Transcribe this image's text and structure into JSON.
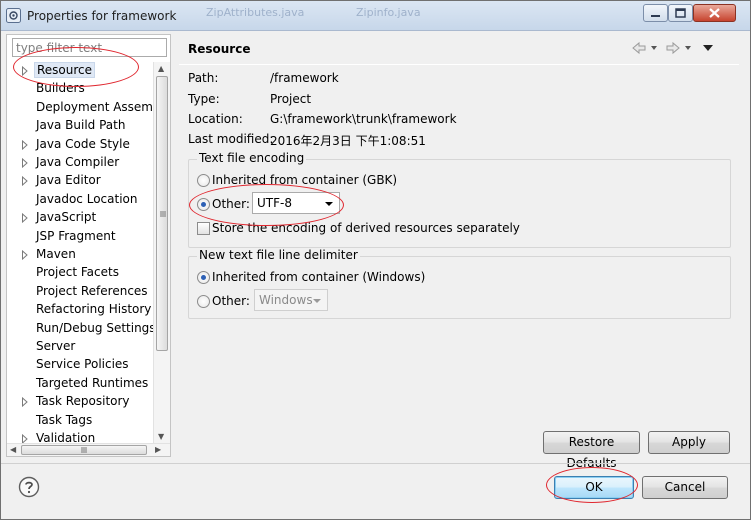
{
  "window": {
    "title": "Properties for framework",
    "background_tabs": [
      "ZipAttributes.java",
      "Zipinfo.java"
    ]
  },
  "filter": {
    "placeholder": "type filter text"
  },
  "tree": {
    "items": [
      {
        "label": "Resource",
        "expandable": true,
        "selected": true
      },
      {
        "label": "Builders",
        "expandable": false
      },
      {
        "label": "Deployment Assembly",
        "expandable": false
      },
      {
        "label": "Java Build Path",
        "expandable": false
      },
      {
        "label": "Java Code Style",
        "expandable": true
      },
      {
        "label": "Java Compiler",
        "expandable": true
      },
      {
        "label": "Java Editor",
        "expandable": true
      },
      {
        "label": "Javadoc Location",
        "expandable": false
      },
      {
        "label": "JavaScript",
        "expandable": true
      },
      {
        "label": "JSP Fragment",
        "expandable": false
      },
      {
        "label": "Maven",
        "expandable": true
      },
      {
        "label": "Project Facets",
        "expandable": false
      },
      {
        "label": "Project References",
        "expandable": false
      },
      {
        "label": "Refactoring History",
        "expandable": false
      },
      {
        "label": "Run/Debug Settings",
        "expandable": false
      },
      {
        "label": "Server",
        "expandable": false
      },
      {
        "label": "Service Policies",
        "expandable": false
      },
      {
        "label": "Targeted Runtimes",
        "expandable": false
      },
      {
        "label": "Task Repository",
        "expandable": true
      },
      {
        "label": "Task Tags",
        "expandable": false
      },
      {
        "label": "Validation",
        "expandable": true
      }
    ]
  },
  "page": {
    "title": "Resource",
    "properties": [
      {
        "label": "Path:",
        "value": "/framework"
      },
      {
        "label": "Type:",
        "value": "Project"
      },
      {
        "label": "Location:",
        "value": "G:\\framework\\trunk\\framework"
      },
      {
        "label": "Last modified:",
        "value": "2016年2月3日 下午1:08:51"
      }
    ],
    "encoding": {
      "group_title": "Text file encoding",
      "inherited_label": "Inherited from container (GBK)",
      "other_label": "Other:",
      "other_value": "UTF-8",
      "selected": "other",
      "store_label": "Store the encoding of derived resources separately",
      "store_checked": false
    },
    "delimiter": {
      "group_title": "New text file line delimiter",
      "inherited_label": "Inherited from container (Windows)",
      "other_label": "Other:",
      "other_value": "Windows",
      "selected": "inherited"
    },
    "restore_defaults_label": "Restore Defaults",
    "apply_label": "Apply"
  },
  "footer": {
    "help_icon": "help-icon",
    "ok_label": "OK",
    "cancel_label": "Cancel"
  },
  "colors": {
    "annotation": "#e0272f",
    "selection": "#dfe8f5",
    "radio_dot": "#2d60b5",
    "title_bar": "#c7d7ea"
  }
}
